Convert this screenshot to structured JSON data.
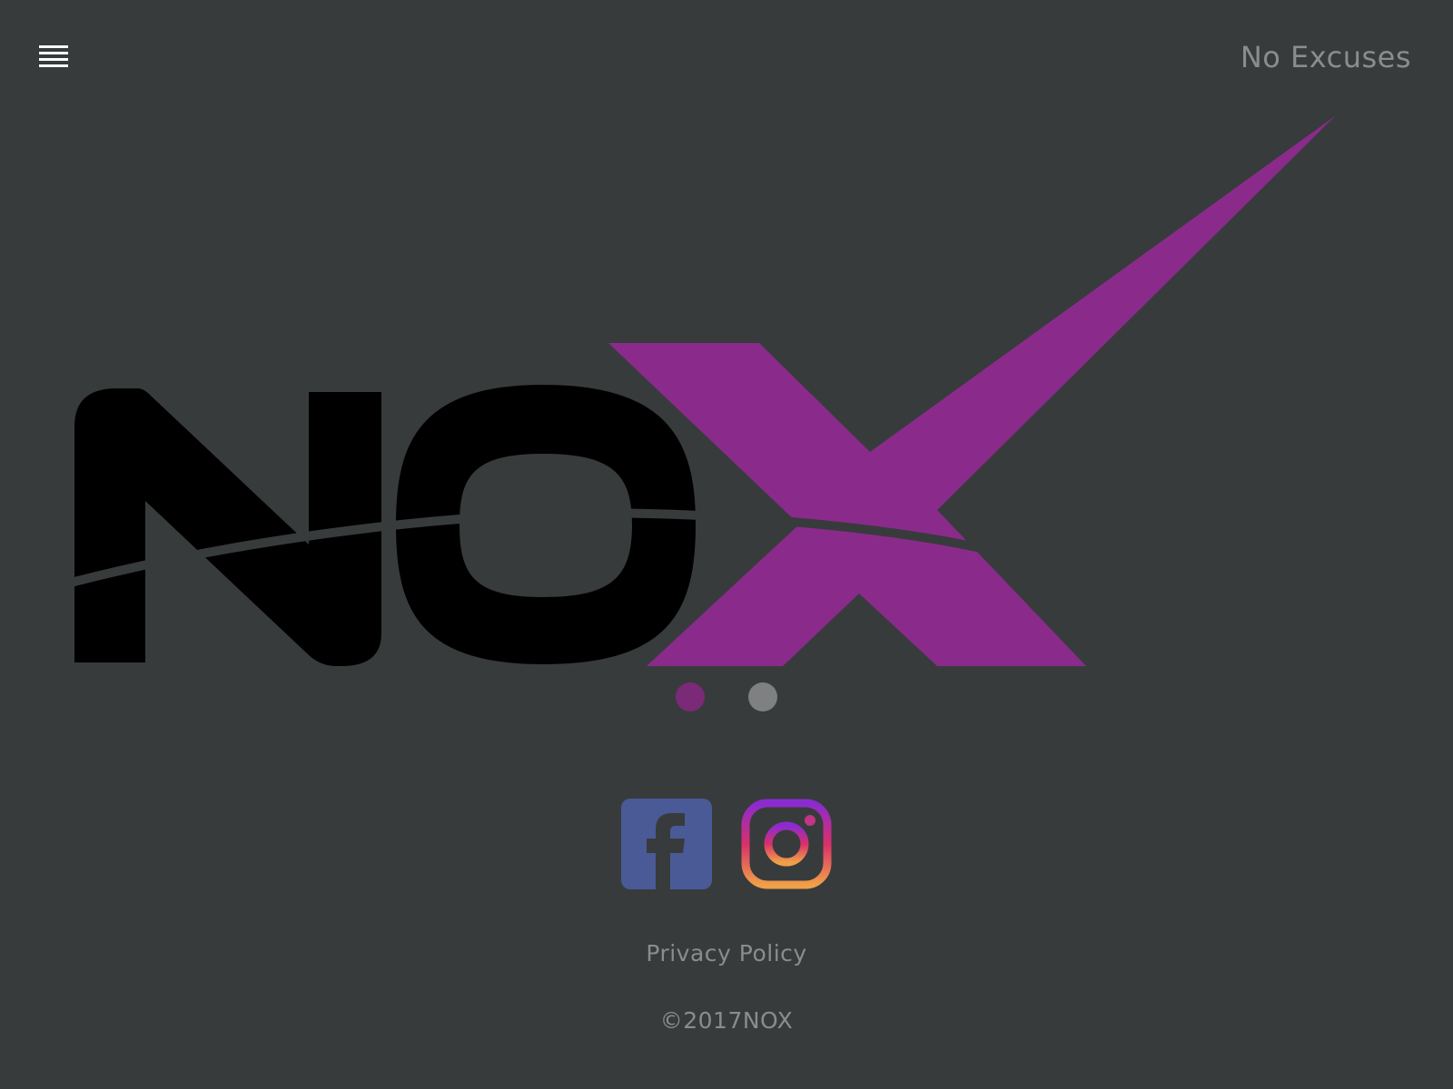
{
  "header": {
    "menu_icon": "hamburger-menu-icon",
    "tagline": "No Excuses"
  },
  "hero": {
    "logo_text": "NOX",
    "logo_colors": {
      "letters": "#000000",
      "x_mark": "#8a2b8c",
      "swoosh": "#383b3c"
    }
  },
  "carousel": {
    "slide_count": 2,
    "active_index": 0,
    "active_color": "#7b2a78",
    "inactive_color": "#7e8082"
  },
  "social": {
    "items": [
      {
        "name": "Facebook",
        "icon": "facebook-icon",
        "color": "#4a5a96"
      },
      {
        "name": "Instagram",
        "icon": "instagram-icon",
        "color": "#c13584"
      }
    ]
  },
  "footer": {
    "privacy_label": "Privacy Policy",
    "copyright": "©2017NOX"
  },
  "colors": {
    "background": "#383b3c",
    "muted_text": "#8a8c8e"
  }
}
